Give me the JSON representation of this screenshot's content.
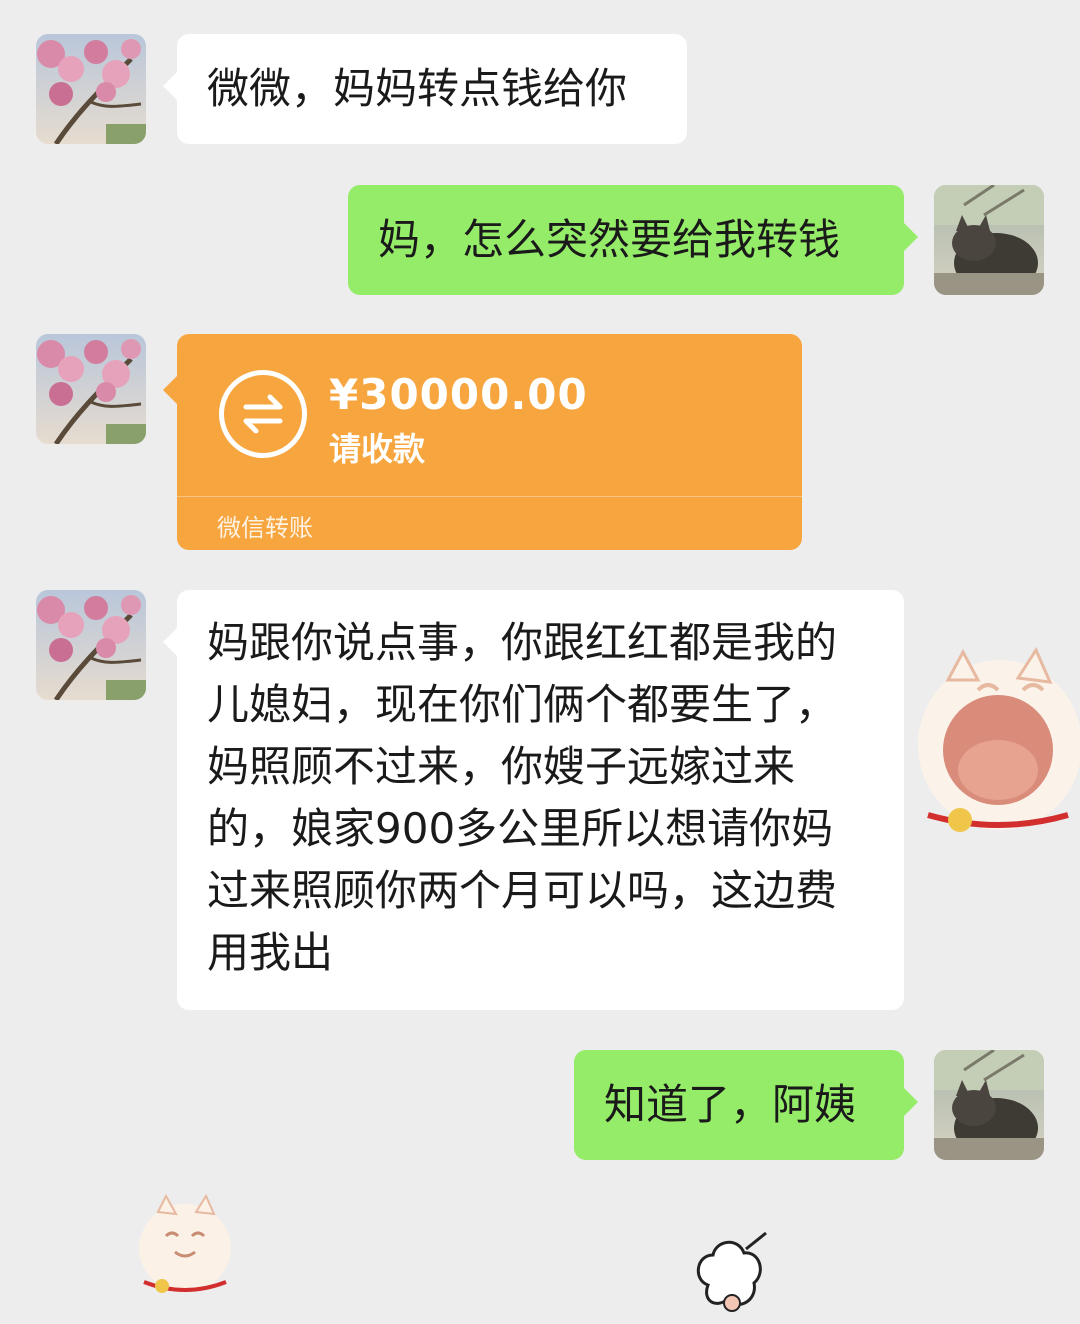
{
  "chat": {
    "messages": [
      {
        "side": "left",
        "text": "微微，妈妈转点钱给你"
      },
      {
        "side": "right",
        "text": "妈，怎么突然要给我转钱"
      },
      {
        "side": "left",
        "type": "transfer"
      },
      {
        "side": "left",
        "text": "妈跟你说点事，你跟红红都是我的儿媳妇，现在你们俩个都要生了，妈照顾不过来，你嫂子远嫁过来的，娘家900多公里所以想请你妈过来照顾你两个月可以吗，这边费用我出"
      },
      {
        "side": "right",
        "text": "知道了，阿姨"
      }
    ],
    "transfer": {
      "amount": "¥30000.00",
      "status": "请收款",
      "footer": "微信转账",
      "icon": "transfer-arrows-icon",
      "color": "#f6a53f"
    },
    "colors": {
      "background": "#ededed",
      "left_bubble": "#ffffff",
      "right_bubble": "#95ec69"
    },
    "stickers": [
      "laughing-cat-sticker",
      "smiling-cat-sticker",
      "cartoon-sticker"
    ]
  }
}
